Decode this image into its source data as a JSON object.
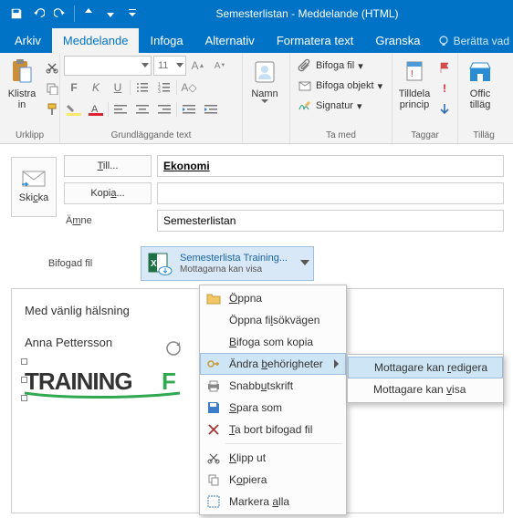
{
  "colors": {
    "accent": "#0173c7"
  },
  "window": {
    "title": "Semesterlistan - Meddelande (HTML)"
  },
  "tabs": {
    "arkiv": "Arkiv",
    "meddelande": "Meddelande",
    "infoga": "Infoga",
    "alternativ": "Alternativ",
    "formatera": "Formatera text",
    "granska": "Granska",
    "tell_me": "Berätta vad"
  },
  "ribbon": {
    "clipboard": {
      "paste": "Klistra\nin",
      "group": "Urklipp"
    },
    "font": {
      "size": "11",
      "group": "Grundläggande text"
    },
    "names": {
      "btn": "Namn",
      "group": ""
    },
    "include": {
      "attach_file": "Bifoga fil",
      "attach_item": "Bifoga objekt",
      "signature": "Signatur",
      "group": "Ta med"
    },
    "tags": {
      "assign": "Tilldela\nprincip",
      "group": "Taggar"
    },
    "addins": {
      "office": "Offic\ntilläg",
      "group": "Tilläg"
    }
  },
  "compose": {
    "send": "Skicka",
    "to_btn": "Till...",
    "cc_btn": "Kopia...",
    "subject_label": "Ämne",
    "to_value": "Ekonomi",
    "cc_value": "",
    "subject_value": "Semesterlistan",
    "attach_label": "Bifogad fil",
    "attach_name": "Semesterlista Training...",
    "attach_status": "Mottagarna kan visa"
  },
  "body": {
    "greeting": "Med vänlig hälsning",
    "name": "Anna Pettersson",
    "logo_text": "TRAININGF"
  },
  "menu": {
    "open": "Öppna",
    "open_path": "Öppna filsökvägen",
    "attach_copy": "Bifoga som kopia",
    "change_perm": "Ändra behörigheter",
    "quick_print": "Snabbutskrift",
    "save_as": "Spara som",
    "remove": "Ta bort bifogad fil",
    "cut": "Klipp ut",
    "copy": "Kopiera",
    "select_all": "Markera alla"
  },
  "submenu": {
    "can_edit": "Mottagare kan redigera",
    "can_view": "Mottagare kan visa"
  }
}
